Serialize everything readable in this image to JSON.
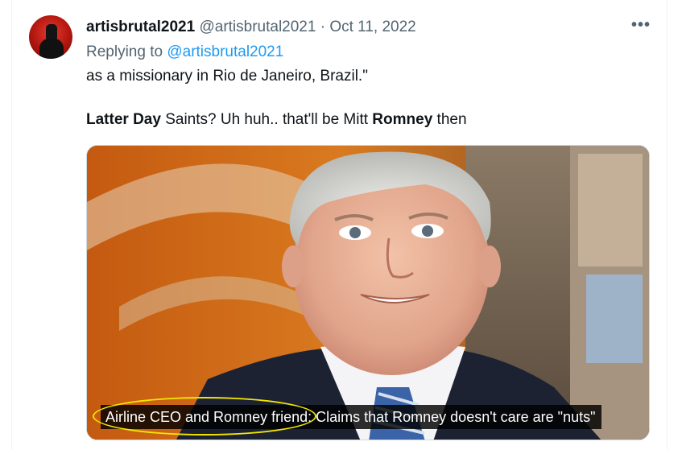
{
  "tweet": {
    "display_name": "artisbrutal2021",
    "handle": "@artisbrutal2021",
    "separator": "·",
    "date": "Oct 11, 2022",
    "more_label": "•••",
    "replying_prefix": "Replying to ",
    "replying_handle": "@artisbrutal2021",
    "text_line1": "as a missionary in Rio de Janeiro, Brazil.\"",
    "text_line2_parts": {
      "p1": "Latter Day",
      "p2": " Saints?  Uh huh.. that'll be Mitt ",
      "p3": "Romney",
      "p4": " then"
    }
  },
  "media": {
    "caption": "Airline CEO and Romney friend: Claims that Romney doesn't care are \"nuts\"",
    "annotation_color": "#f3e600"
  },
  "colors": {
    "link": "#1d9bf0",
    "muted": "#536471",
    "text": "#0f1419"
  }
}
